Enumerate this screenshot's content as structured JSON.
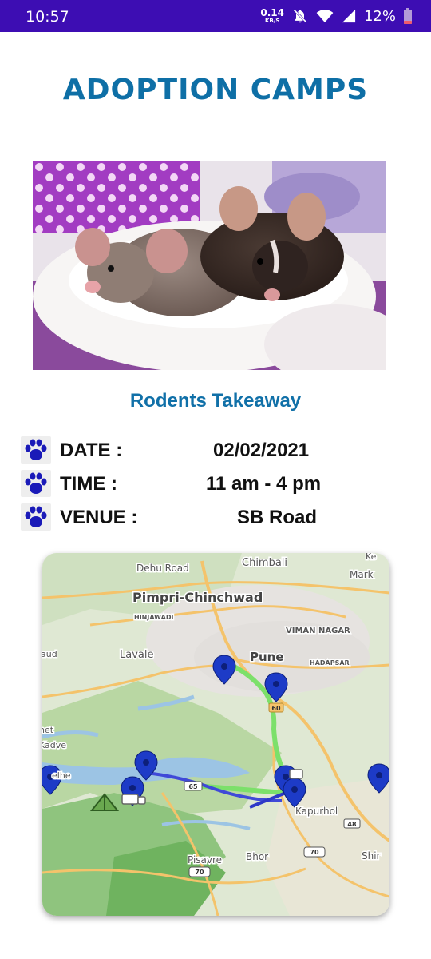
{
  "status_bar": {
    "time": "10:57",
    "net_speed_value": "0.14",
    "net_speed_unit": "KB/S",
    "battery": "12%"
  },
  "page": {
    "title": "ADOPTION CAMPS"
  },
  "event": {
    "name": "Rodents Takeaway",
    "details": [
      {
        "label": "DATE :",
        "value": "02/02/2021"
      },
      {
        "label": "TIME :",
        "value": "11 am - 4 pm"
      },
      {
        "label": "VENUE :",
        "value": "SB Road"
      }
    ]
  },
  "map": {
    "places": {
      "chimbali": "Chimbali",
      "dehu_road": "Dehu Road",
      "mark": "Mark",
      "ke": "Ke",
      "pimpri": "Pimpri-Chinchwad",
      "hinjawadi": "HINJAWADI",
      "viman_nagar": "VIMAN NAGAR",
      "aud": "aud",
      "lavale": "Lavale",
      "pune": "Pune",
      "hadapsar": "HADAPSAR",
      "het": "het",
      "kadve": "Kadve",
      "elhe": "elhe",
      "kapurhol": "Kapurhol",
      "bhor": "Bhor",
      "pisavre": "Pisavre",
      "shir": "Shir"
    },
    "road_shields": {
      "r60": "60",
      "r65": "65",
      "r48": "48",
      "r70a": "70",
      "r70b": "70"
    }
  }
}
